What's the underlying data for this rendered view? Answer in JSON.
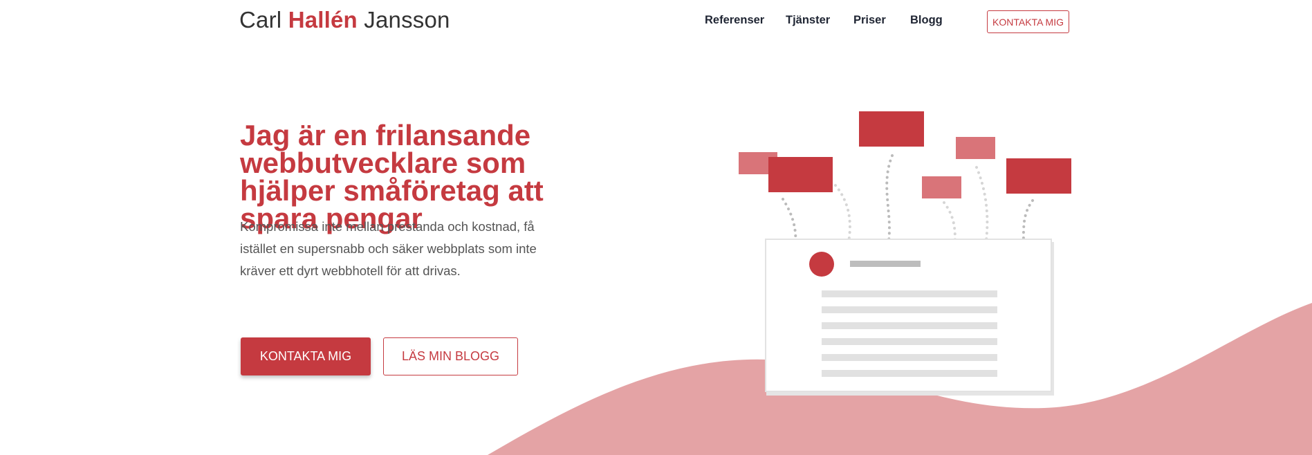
{
  "header": {
    "logo": {
      "first": "Carl ",
      "middle": "Hallén",
      "last": " Jansson"
    },
    "nav": [
      {
        "label": "Referenser"
      },
      {
        "label": "Tjänster"
      },
      {
        "label": "Priser"
      },
      {
        "label": "Blogg"
      }
    ],
    "cta_label": "KONTAKTA MIG"
  },
  "hero": {
    "headline": "Jag är en frilansande webbutvecklare som hjälper småföretag att spara pengar",
    "lead": "Kompromissa inte mellan prestanda och kostnad, få istället en supersnabb och säker webbplats som inte kräver ett dyrt webbhotell för att drivas.",
    "primary_button": "KONTAKTA MIG",
    "secondary_button": "LÄS MIN BLOGG"
  },
  "theme": {
    "accent": "#c53a40",
    "accent_light": "#e4a3a5",
    "nav_text": "#1f2533"
  }
}
